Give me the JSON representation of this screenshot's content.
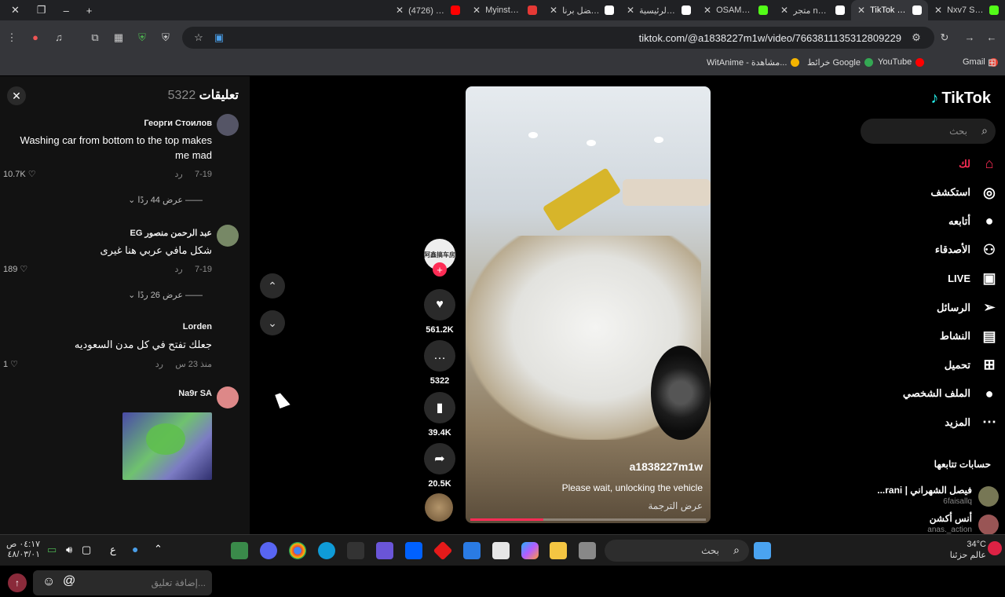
{
  "browser": {
    "tabs": [
      {
        "title": "Nxv7 Stream - W",
        "color": "#53fc18",
        "icon": "kick-icon"
      },
      {
        "title": "TikTok - Make",
        "color": "#ffffff",
        "icon": "tiktok-icon",
        "active": true
      },
      {
        "title": "متجر nxv7 | أفضل",
        "color": "#ffffff",
        "icon": "diamond-icon"
      },
      {
        "title": "OSAMAH Stream",
        "color": "#53fc18",
        "icon": "kick-icon"
      },
      {
        "title": "الرئيسية \\ X",
        "color": "#ffffff",
        "icon": "x-icon"
      },
      {
        "title": "الولاء | أفضل برنا",
        "color": "#ffffff",
        "icon": "diamond-icon"
      },
      {
        "title": "Myinstants | The",
        "color": "#e53935",
        "icon": "myinstants-icon"
      },
      {
        "title": "(4726) طريقة انش",
        "color": "#ff0000",
        "icon": "youtube-icon"
      }
    ],
    "url": "tiktok.com/@a1838227m1w/video/7663811135312809229",
    "bookmarks": [
      {
        "label": "Gmail",
        "color": "#ea4335"
      },
      {
        "label": "YouTube",
        "color": "#ff0000"
      },
      {
        "label": "خرائط Google",
        "color": "#34a853"
      },
      {
        "label": "WitAnime - مشاهدة...",
        "color": "#f4b400"
      }
    ]
  },
  "comments": {
    "title": "تعليقات",
    "count": "5322",
    "items": [
      {
        "user": "Георги Стоилов",
        "text": "Washing car from bottom to the top makes me mad",
        "date": "7-19",
        "reply": "رد",
        "likes": "10.7K",
        "view_replies": "عرض 44 ردًا"
      },
      {
        "user": "عبد الرحمن منصور EG",
        "text": "شكل مافي عربي هنا غيرى",
        "date": "7-19",
        "reply": "رد",
        "likes": "189",
        "view_replies": "عرض 26 ردًا"
      },
      {
        "user": "Lorden",
        "text": "جعلك تفتح في كل مدن السعوديه",
        "date": "منذ 23 س",
        "reply": "رد",
        "likes": "1"
      },
      {
        "user": "Na9r SA"
      }
    ],
    "add_placeholder": "إضافة تعليق..."
  },
  "video": {
    "username": "a1838227m1w",
    "caption": "Please wait, unlocking the vehicle",
    "translate": "عرض الترجمة",
    "profile_badge": "阿鑫搞车房",
    "progress": 0.31,
    "actions": {
      "likes": "561.2K",
      "comments": "5322",
      "saves": "39.4K",
      "shares": "20.5K"
    }
  },
  "sidebar": {
    "logo": "TikTok",
    "search_placeholder": "بحث",
    "nav": [
      {
        "label": "لك",
        "icon": "home-icon",
        "selected": true
      },
      {
        "label": "استكشف",
        "icon": "compass-icon"
      },
      {
        "label": "أتابعه",
        "icon": "following-avatar-icon"
      },
      {
        "label": "الأصدقاء",
        "icon": "friends-icon"
      },
      {
        "label": "LIVE",
        "icon": "live-icon"
      },
      {
        "label": "الرسائل",
        "icon": "send-icon"
      },
      {
        "label": "النشاط",
        "icon": "activity-icon"
      },
      {
        "label": "تحميل",
        "icon": "upload-icon"
      },
      {
        "label": "الملف الشخصي",
        "icon": "profile-icon"
      },
      {
        "label": "المزيد",
        "icon": "more-icon"
      }
    ],
    "following_title": "حسابات تتابعها",
    "following": [
      {
        "name": "فيصل الشهراني | rani...",
        "handle": "6faisallq"
      },
      {
        "name": "أنس أكشن",
        "handle": "anas._action"
      }
    ]
  },
  "taskbar": {
    "search": "بحث",
    "time": "٠٤:١٧ ص",
    "date": "٤٨/٠٣/٠١",
    "lang": "ع",
    "weather_temp": "34°C",
    "weather_text": "عالم حزئنا"
  }
}
